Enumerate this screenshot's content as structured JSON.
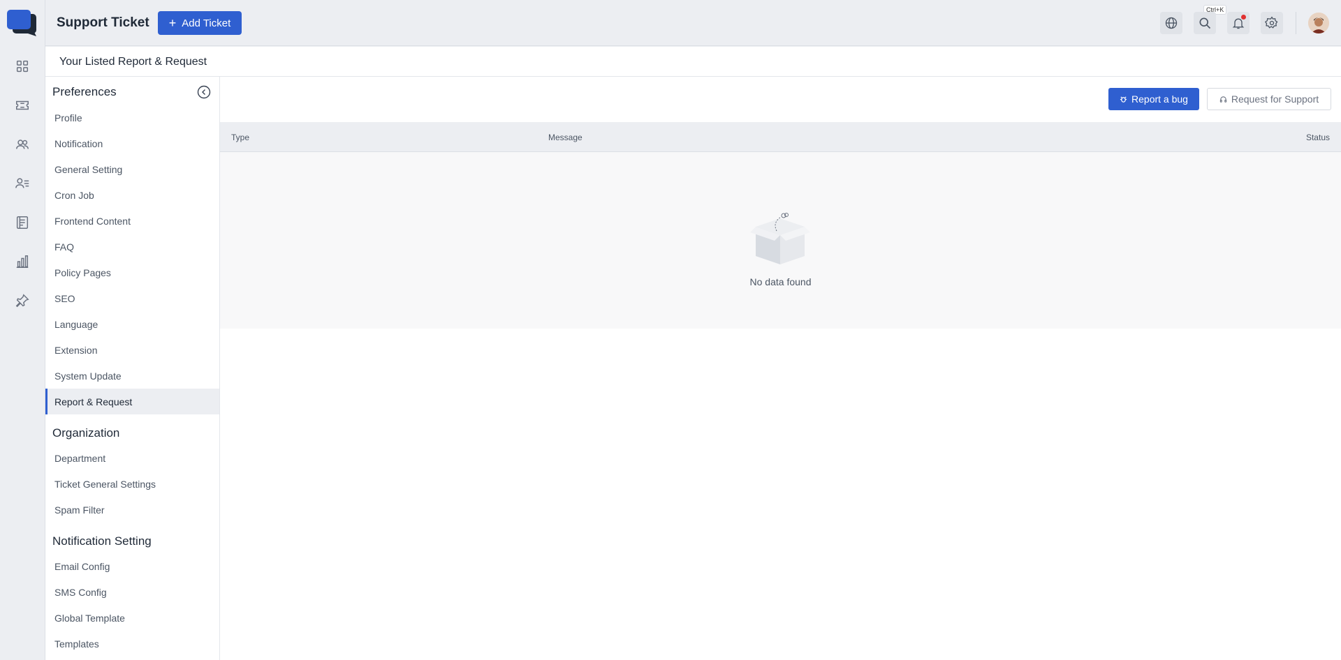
{
  "header": {
    "title": "Support Ticket",
    "add_ticket_label": "Add Ticket",
    "search_shortcut": "Ctrl+K"
  },
  "rail": {
    "icons": [
      "dashboard-icon",
      "ticket-icon",
      "users-icon",
      "agents-icon",
      "articles-icon",
      "reports-icon",
      "pin-icon"
    ]
  },
  "page": {
    "title": "Your Listed Report & Request"
  },
  "sidebar": {
    "sections": [
      {
        "title": "Preferences",
        "items": [
          "Profile",
          "Notification",
          "General Setting",
          "Cron Job",
          "Frontend Content",
          "FAQ",
          "Policy Pages",
          "SEO",
          "Language",
          "Extension",
          "System Update",
          "Report & Request"
        ]
      },
      {
        "title": "Organization",
        "items": [
          "Department",
          "Ticket General Settings",
          "Spam Filter"
        ]
      },
      {
        "title": "Notification Setting",
        "items": [
          "Email Config",
          "SMS Config",
          "Global Template",
          "Templates"
        ]
      }
    ],
    "active_item": "Report & Request"
  },
  "actions": {
    "report_bug": "Report a bug",
    "request_support": "Request for Support"
  },
  "table": {
    "columns": [
      "Type",
      "Message",
      "Status"
    ],
    "empty_text": "No data found"
  },
  "colors": {
    "accent": "#2f5fd0",
    "background": "#eceef2"
  }
}
